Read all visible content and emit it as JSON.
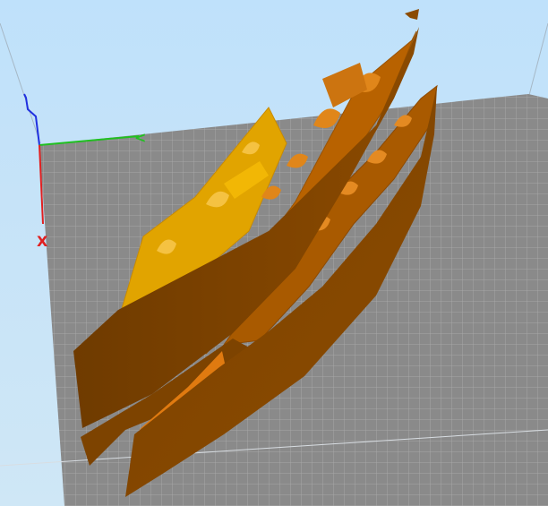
{
  "viewport": {
    "background": "#c6e3f8",
    "bed_color": "#8c8c8c",
    "grid_line_color": "#a9a9a9"
  },
  "axes": {
    "x": {
      "label": "X",
      "color": "#e02020"
    },
    "y": {
      "label": "<",
      "color": "#20c020"
    },
    "z": {
      "label": "",
      "color": "#2030e0"
    }
  },
  "model": {
    "primary_color": "#8b4a00",
    "highlight_color": "#d98a1a",
    "accent_color": "#f2b705"
  }
}
